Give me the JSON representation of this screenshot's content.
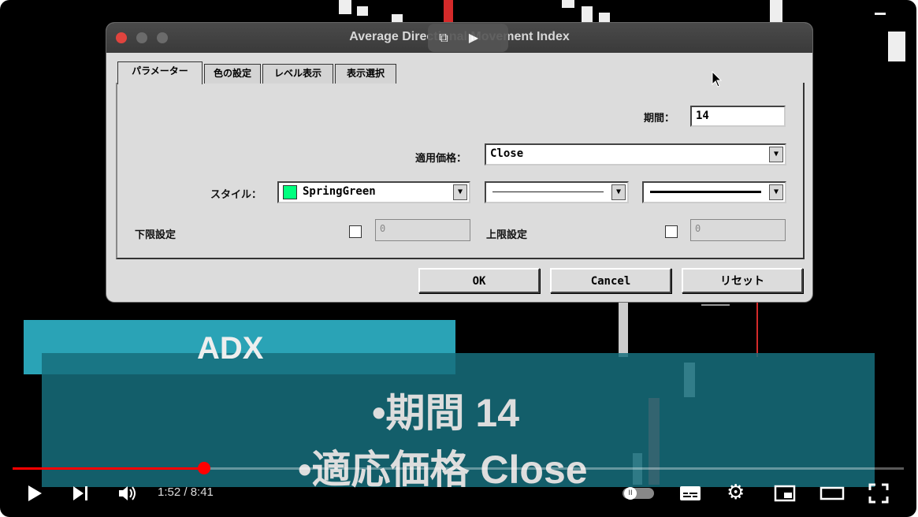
{
  "dialog": {
    "title": "Average Directional Movement Index",
    "tabs": [
      "パラメーター",
      "色の設定",
      "レベル表示",
      "表示選択"
    ],
    "period_label": "期間：",
    "period_value": "14",
    "price_label": "適用価格：",
    "price_value": "Close",
    "style_label": "スタイル：",
    "style_color": "SpringGreen",
    "style_color_hex": "#00ff7f",
    "lower_label": "下限設定",
    "lower_value": "0",
    "upper_label": "上限設定",
    "upper_value": "0",
    "buttons": {
      "ok": "OK",
      "cancel": "Cancel",
      "reset": "リセット"
    }
  },
  "caption": {
    "heading": "ADX",
    "line1": "•期間 14",
    "line2": "•適応価格 Close"
  },
  "player": {
    "time": "1:52 / 8:41",
    "progress": 0.215,
    "icons": [
      "play-icon",
      "next-icon",
      "volume-icon",
      "autoplay-toggle-icon",
      "subtitles-icon",
      "settings-icon",
      "miniplayer-icon",
      "theater-icon",
      "fullscreen-icon"
    ]
  }
}
